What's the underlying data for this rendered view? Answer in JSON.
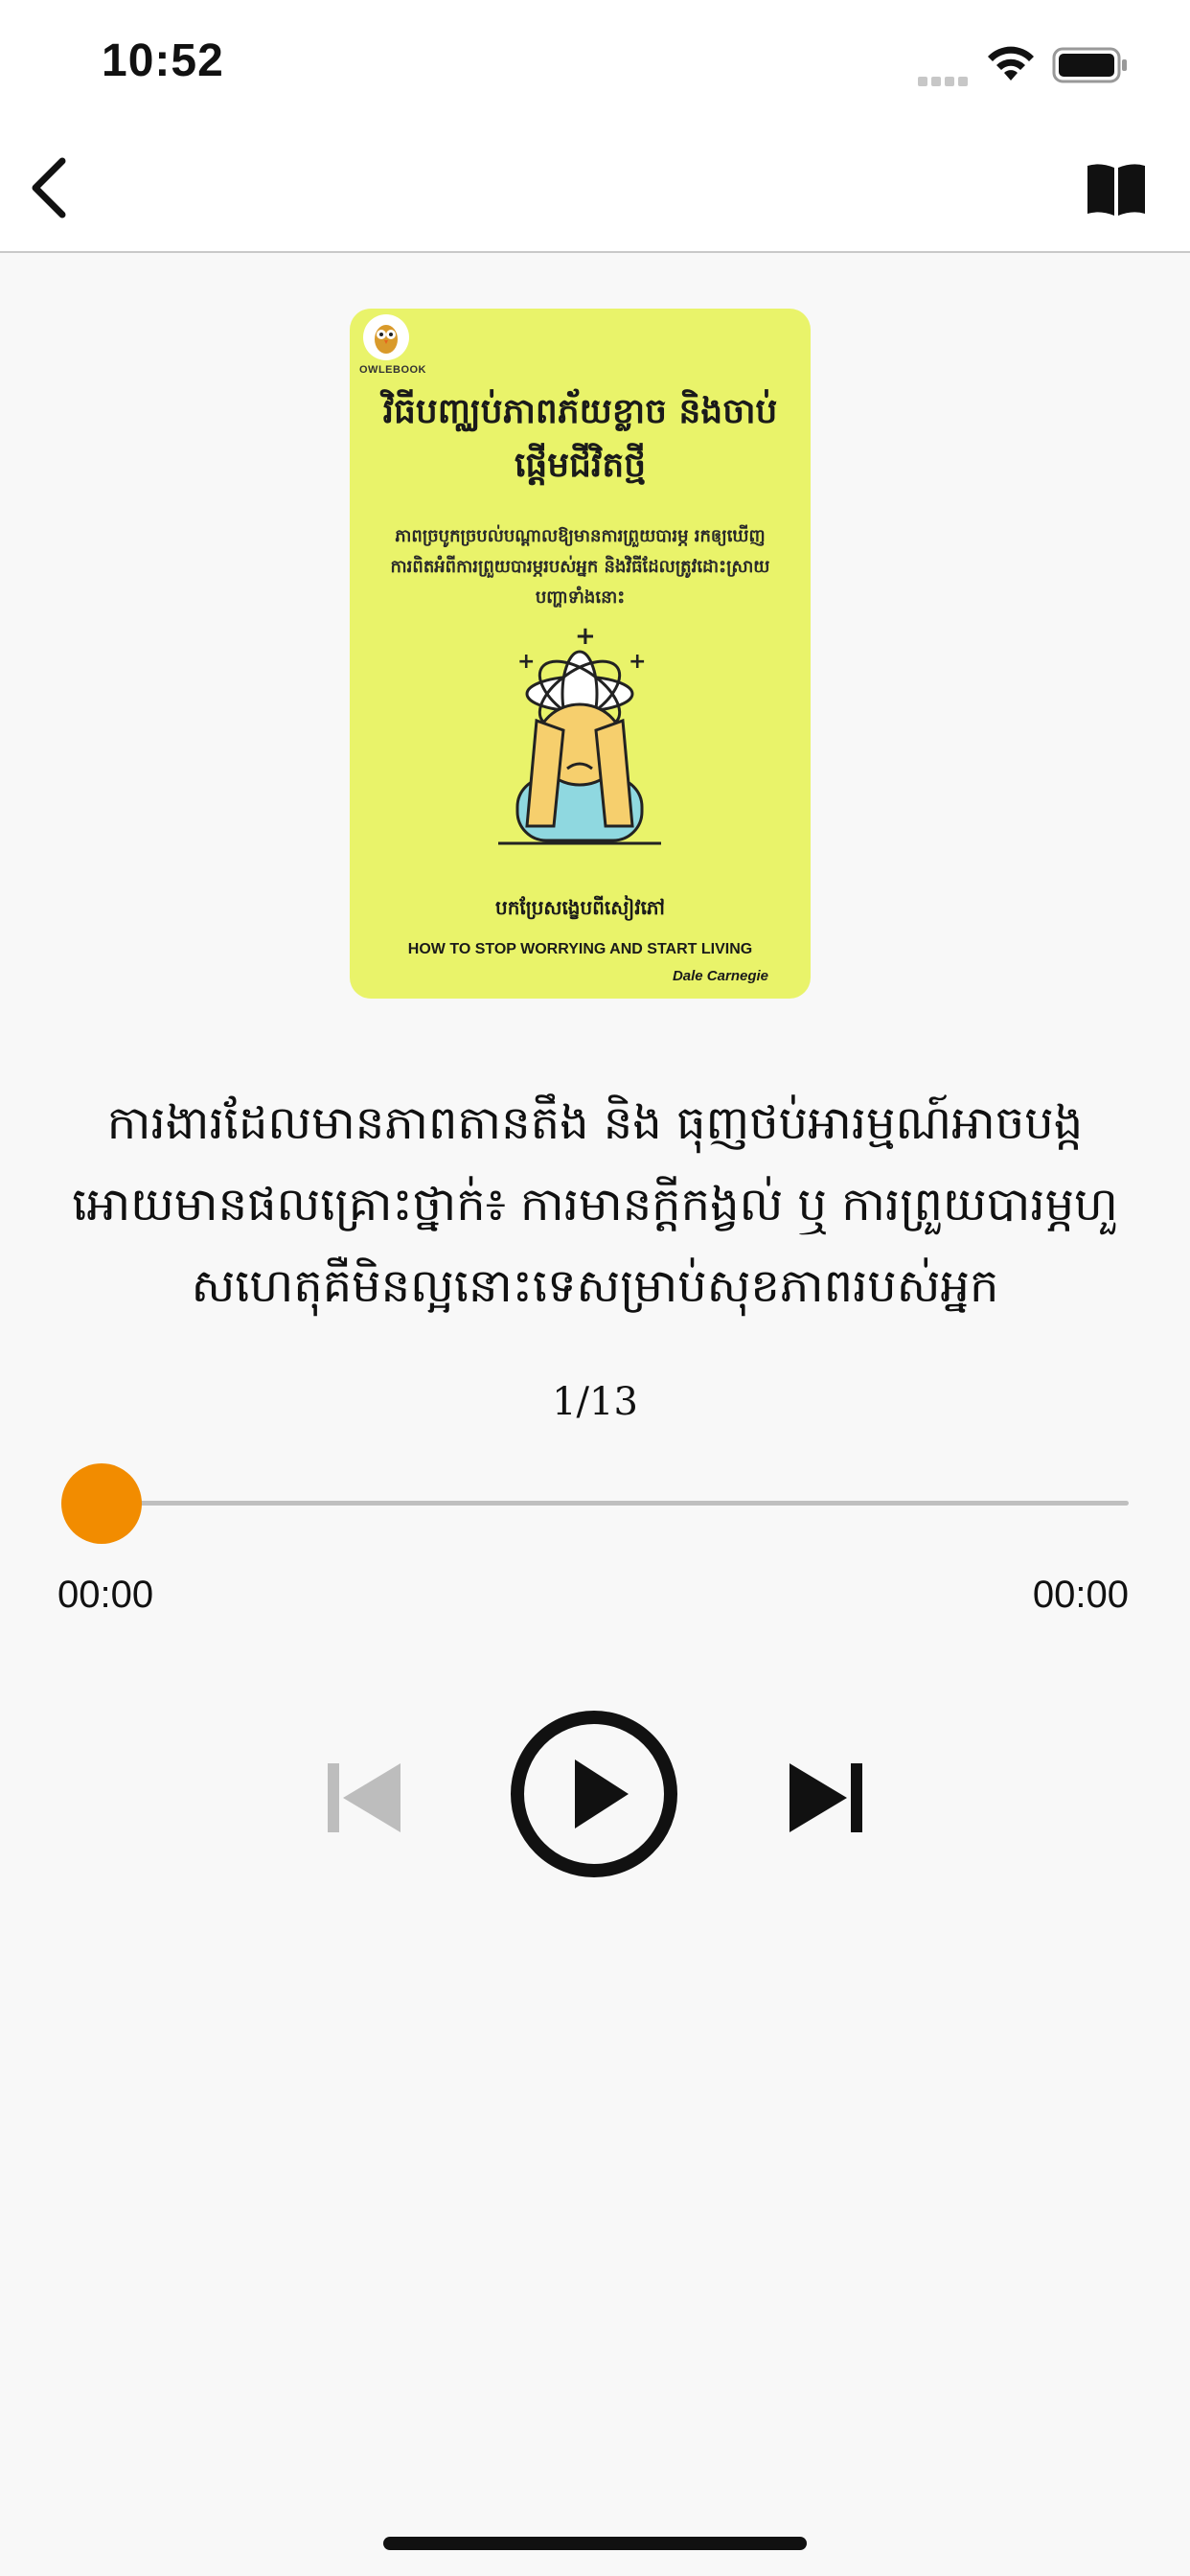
{
  "status_bar": {
    "time": "10:52"
  },
  "cover": {
    "publisher": "OWLEBOOK",
    "title_khmer": "វិធីបញ្ឈប់ភាពភ័យខ្លាច និងចាប់ផ្តើមជីវិតថ្មី",
    "subtitle_khmer": "ភាពច្របូកច្របល់បណ្តាលឱ្យមានការព្រួយបារម្ភ រកឲ្យឃើញការពិតអំពីការព្រួយបារម្ភរបស់អ្នក និងវិធីដែលត្រូវដោះស្រាយបញ្ហាទាំងនោះ",
    "translated_khmer": "បកប្រែសង្ខេបពីសៀវភៅ",
    "english_title": "HOW TO STOP WORRYING AND START LIVING",
    "author": "Dale Carnegie",
    "bg_color": "#e9f36a"
  },
  "quote": "ការងារដែលមានភាពតានតឹង និង ធុញថប់អារម្មណ៍អាចបង្កអោយមានផលគ្រោះថ្នាក់៖ ការមានក្តីកង្វល់ ឬ ការព្រួយបារម្ភហួសហេតុគឺមិនល្អនោះទេសម្រាប់សុខភាពរបស់អ្នក",
  "player": {
    "page": "1/13",
    "elapsed": "00:00",
    "total": "00:00",
    "progress": 0,
    "accent_color": "#f28c00"
  },
  "icons": {
    "back": "chevron-left-icon",
    "book": "open-book-icon",
    "prev": "skip-previous-icon",
    "play": "play-icon",
    "next": "skip-next-icon"
  }
}
